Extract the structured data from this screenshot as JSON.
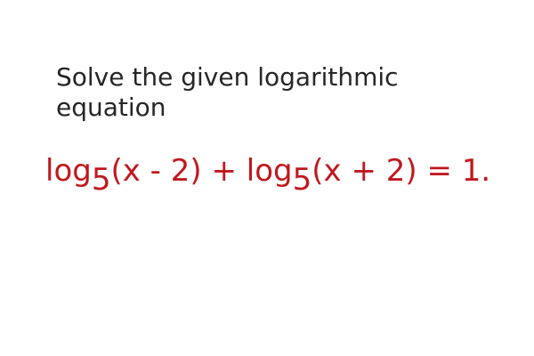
{
  "prompt": {
    "line1": "Solve the given logarithmic",
    "line2": "equation"
  },
  "equation": {
    "log1": "log",
    "base1": "5",
    "arg1": "(x - 2) + ",
    "log2": "log",
    "base2": "5",
    "arg2": "(x + 2) = 1."
  },
  "colors": {
    "text": "#262626",
    "equation": "#c0181e"
  }
}
